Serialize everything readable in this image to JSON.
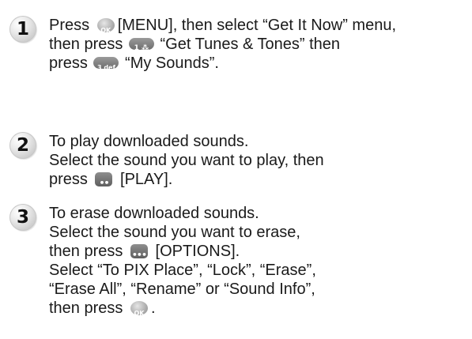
{
  "steps": [
    {
      "number": "1",
      "lines": [
        {
          "a": "Press",
          "b": "[MENU], then select “Get It Now” menu,"
        },
        {
          "a": "then press",
          "b": "“Get Tunes & Tones” then"
        },
        {
          "a": "press",
          "b": "“My Sounds”."
        }
      ],
      "icons": [
        "ok-key-icon",
        "key-1-icon",
        "key-3-icon"
      ]
    },
    {
      "number": "2",
      "lines": [
        {
          "a": "To play downloaded sounds."
        },
        {
          "a": "Select the sound you want to play, then"
        },
        {
          "a": "press",
          "b": "[PLAY]."
        }
      ],
      "icons": [
        "right-soft-key-icon"
      ]
    },
    {
      "number": "3",
      "lines": [
        {
          "a": "To erase downloaded sounds."
        },
        {
          "a": "Select the sound you want to erase,"
        },
        {
          "a": "then press",
          "b": "[OPTIONS]."
        },
        {
          "a": "Select “To PIX Place”, “Lock”, “Erase”,"
        },
        {
          "a": "“Erase All”, “Rename” or “Sound Info”,"
        },
        {
          "a": "then press",
          "b": "."
        }
      ],
      "icons": [
        "options-soft-key-icon",
        "ok-key-icon"
      ]
    }
  ]
}
